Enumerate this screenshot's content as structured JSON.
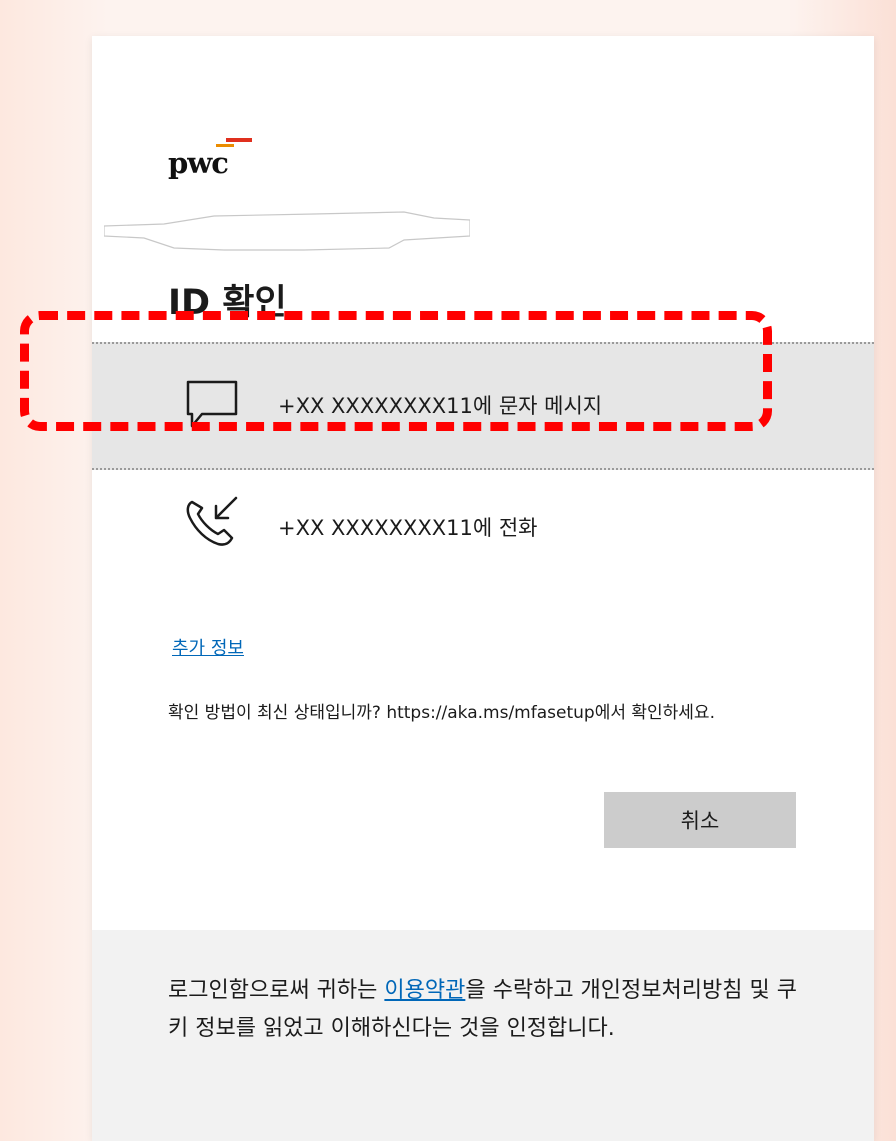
{
  "brand": {
    "logo_text": "pwc"
  },
  "page": {
    "title": "ID 확인"
  },
  "options": [
    {
      "icon": "chat-bubble-icon",
      "label": "+XX XXXXXXXX11에 문자 메시지"
    },
    {
      "icon": "phone-incoming-icon",
      "label": "+XX XXXXXXXX11에 전화"
    }
  ],
  "more_info_link": "추가 정보",
  "verify_note": "확인 방법이 최신 상태입니까? https://aka.ms/mfasetup에서 확인하세요.",
  "buttons": {
    "cancel": "취소"
  },
  "footer": {
    "prefix": "로그인함으로써 귀하는 ",
    "terms_link": "이용약관",
    "suffix": "을 수락하고 개인정보처리방침 및 쿠키 정보를 읽었고 이해하신다는 것을 인정합니다."
  },
  "colors": {
    "link": "#0067b8",
    "highlight": "#ff0000",
    "logo_red": "#e0301e",
    "logo_orange": "#eb8c00"
  }
}
